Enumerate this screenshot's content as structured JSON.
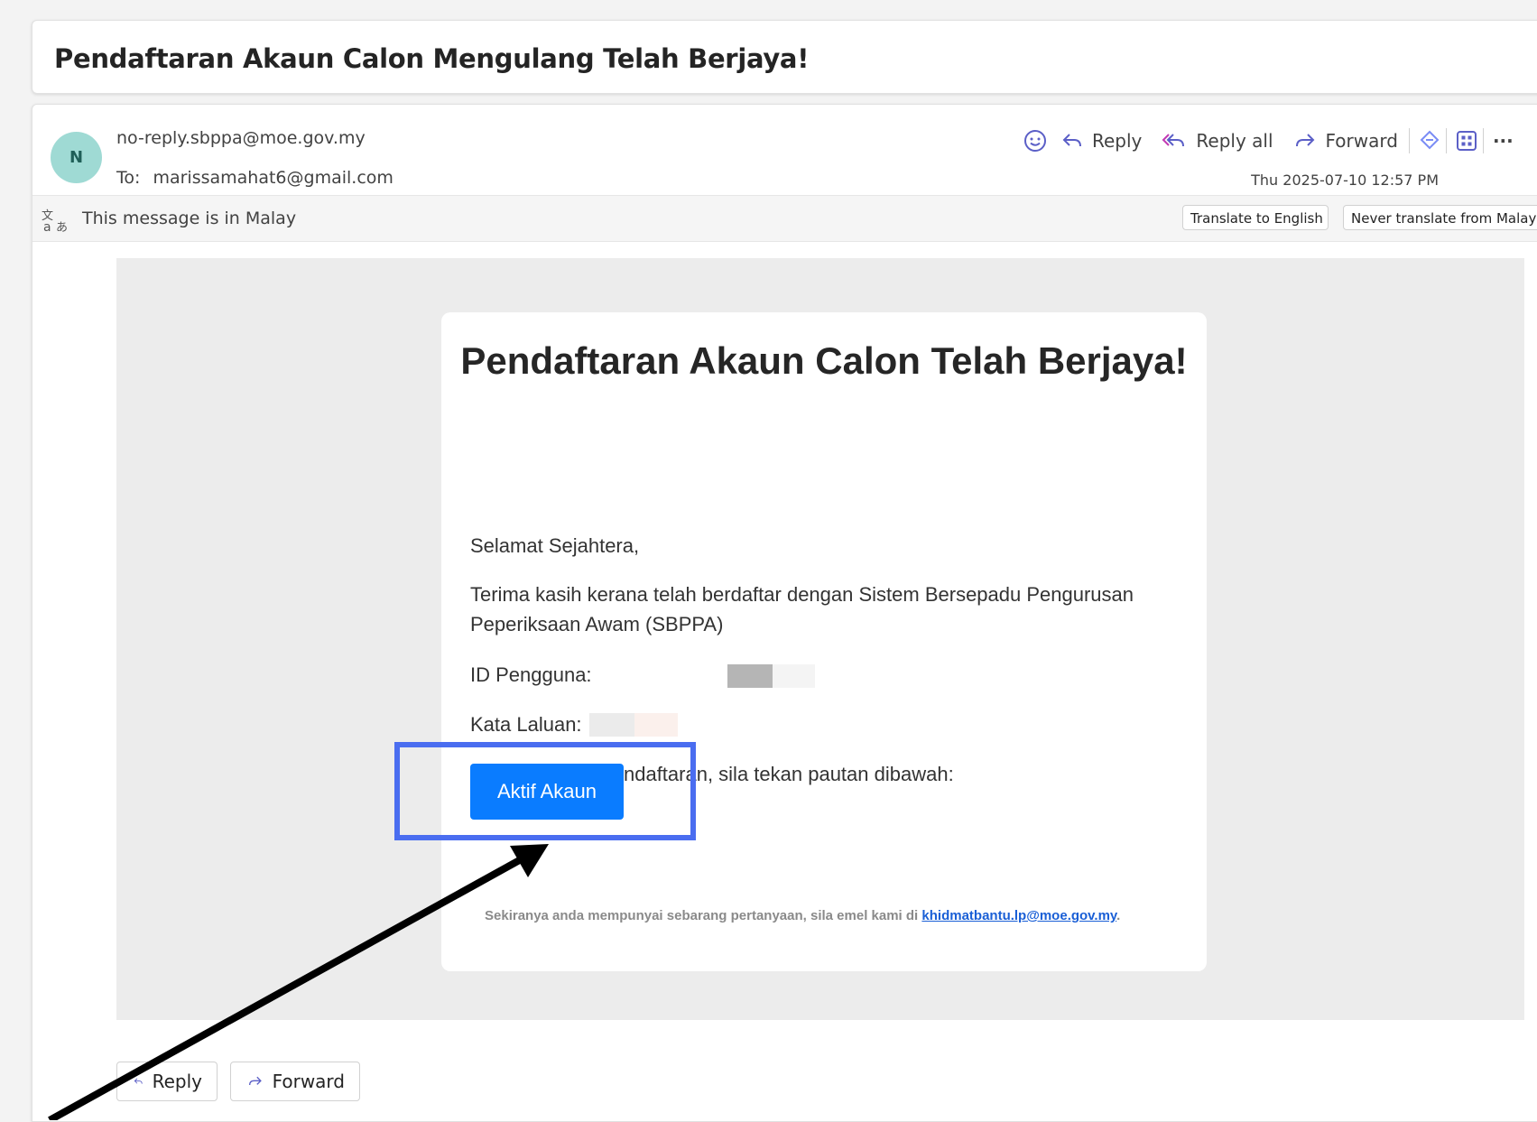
{
  "subject": "Pendaftaran Akaun Calon Mengulang Telah Berjaya!",
  "sender": {
    "avatar_initial": "N",
    "email": "no-reply.sbppa@moe.gov.my",
    "to_label": "To:",
    "to_email": "marissamahat6@gmail.com"
  },
  "actions": {
    "reply": "Reply",
    "reply_all": "Reply all",
    "forward": "Forward",
    "more": "···"
  },
  "timestamp": "Thu 2025-07-10 12:57 PM",
  "translate": {
    "message": "This message is in Malay",
    "translate_button": "Translate to English",
    "never_button": "Never translate from Malay"
  },
  "email_body": {
    "title": "Pendaftaran Akaun Calon Telah Berjaya!",
    "greeting": "Selamat Sejahtera,",
    "thanks": "Terima kasih kerana telah berdaftar dengan Sistem Bersepadu Pengurusan Peperiksaan Awam (SBPPA)",
    "user_id_label": "ID Pengguna:",
    "password_label": "Kata Laluan:",
    "activate_instruction": "Untuk aktifkan pendaftaran, sila tekan pautan dibawah:",
    "activate_button": "Aktif Akaun",
    "footer_text": "Sekiranya anda mempunyai sebarang pertanyaan, sila emel kami di",
    "footer_link": "khidmatbantu.lp@moe.gov.my",
    "footer_end": "."
  },
  "bottom_actions": {
    "reply": "Reply",
    "forward": "Forward"
  },
  "colors": {
    "accent": "#0a7cff",
    "highlight": "#4a6df0",
    "avatar": "#9fdad4",
    "link": "#1a5fd6"
  }
}
